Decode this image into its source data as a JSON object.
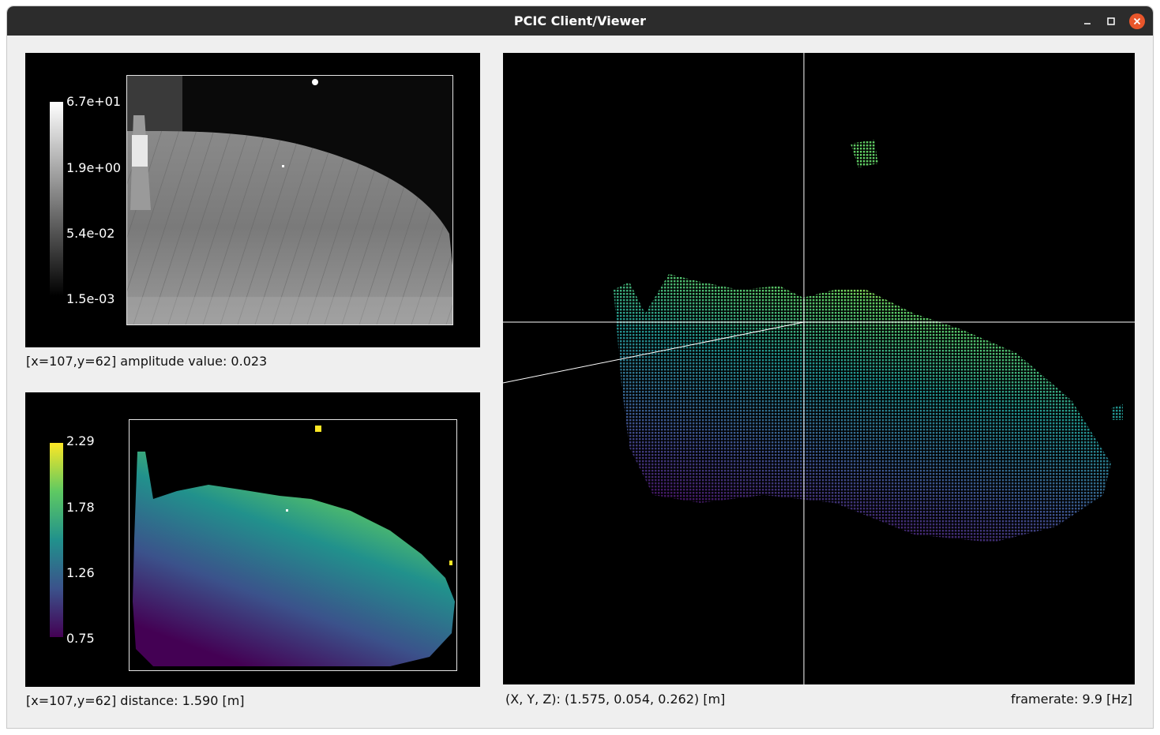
{
  "window": {
    "title": "PCIC Client/Viewer",
    "controls": {
      "minimize": "minimize-icon",
      "maximize": "maximize-icon",
      "close": "close-icon"
    },
    "close_color": "#e9562b"
  },
  "amplitude": {
    "colorbar_ticks": [
      "6.7e+01",
      "1.9e+00",
      "5.4e-02",
      "1.5e-03"
    ],
    "status": "[x=107,y=62] amplitude value: 0.023"
  },
  "distance": {
    "colorbar_ticks": [
      "2.29",
      "1.78",
      "1.26",
      "0.75"
    ],
    "status": "[x=107,y=62] distance: 1.590 [m]"
  },
  "pointcloud": {
    "coords": "(X, Y, Z): (1.575, 0.054, 0.262) [m]",
    "framerate": "framerate: 9.9 [Hz]"
  },
  "colormap": {
    "viridis": [
      "#440154",
      "#3b528b",
      "#21918c",
      "#5ec962",
      "#fde725"
    ]
  }
}
